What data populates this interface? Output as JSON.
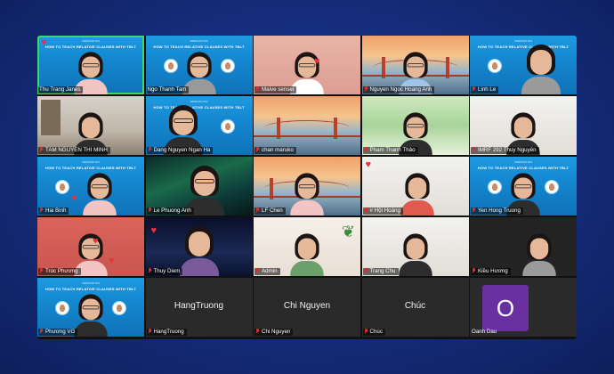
{
  "meeting": {
    "slide_title": "HOW TO TEACH RELATIVE CLAUSES WITH TBLT",
    "slide_subtitle": "WEBINAR #03",
    "participants": [
      {
        "name": "Thu Trang Janes",
        "muted": false,
        "reaction": "heart",
        "active": true
      },
      {
        "name": "Ngo Thanh Tam",
        "muted": false
      },
      {
        "name": "Maive sensei",
        "muted": true,
        "reaction": "heart"
      },
      {
        "name": "Nguyen Ngoc Hoang Anh",
        "muted": true
      },
      {
        "name": "Linh Le",
        "muted": true
      },
      {
        "name": "TAM NGUYEN THI MINH",
        "muted": true
      },
      {
        "name": "Dang Nguyen Ngan Ha",
        "muted": true
      },
      {
        "name": "chan maruko",
        "muted": true
      },
      {
        "name": "Pham Thanh Thảo",
        "muted": true
      },
      {
        "name": "IMRF 292 Thuy Nguyễn",
        "muted": true
      },
      {
        "name": "Hai Binh",
        "muted": true,
        "reaction": "heart"
      },
      {
        "name": "Le Phuong Anh",
        "muted": true
      },
      {
        "name": "LF Chen",
        "muted": true
      },
      {
        "name": "# Hội Hoàng",
        "muted": true,
        "reaction": "heart"
      },
      {
        "name": "Yen Hong Truong",
        "muted": true
      },
      {
        "name": "Trúc Phương",
        "muted": true,
        "reaction": "heart"
      },
      {
        "name": "Thuy Diem",
        "muted": true,
        "reaction": "heart"
      },
      {
        "name": "Admin",
        "muted": true
      },
      {
        "name": "Trang Chu",
        "muted": true
      },
      {
        "name": "Kiều Hương",
        "muted": true
      },
      {
        "name": "Phương VG",
        "muted": true
      },
      {
        "name": "HangTruong",
        "muted": true,
        "no_video": true
      },
      {
        "name": "Chi Nguyen",
        "muted": true,
        "no_video": true
      },
      {
        "name": "Chúc",
        "muted": true,
        "no_video": true
      },
      {
        "name": "Oanh Dau",
        "muted": false,
        "no_video": true,
        "avatar_letter": "O"
      }
    ]
  },
  "colors": {
    "background": "#152c7a",
    "active_speaker": "#3fd66b",
    "muted_icon": "#e02c2c",
    "avatar": "#6a2fa0"
  },
  "icons": {
    "muted": "muted-mic-icon",
    "reaction": "heart-icon"
  }
}
